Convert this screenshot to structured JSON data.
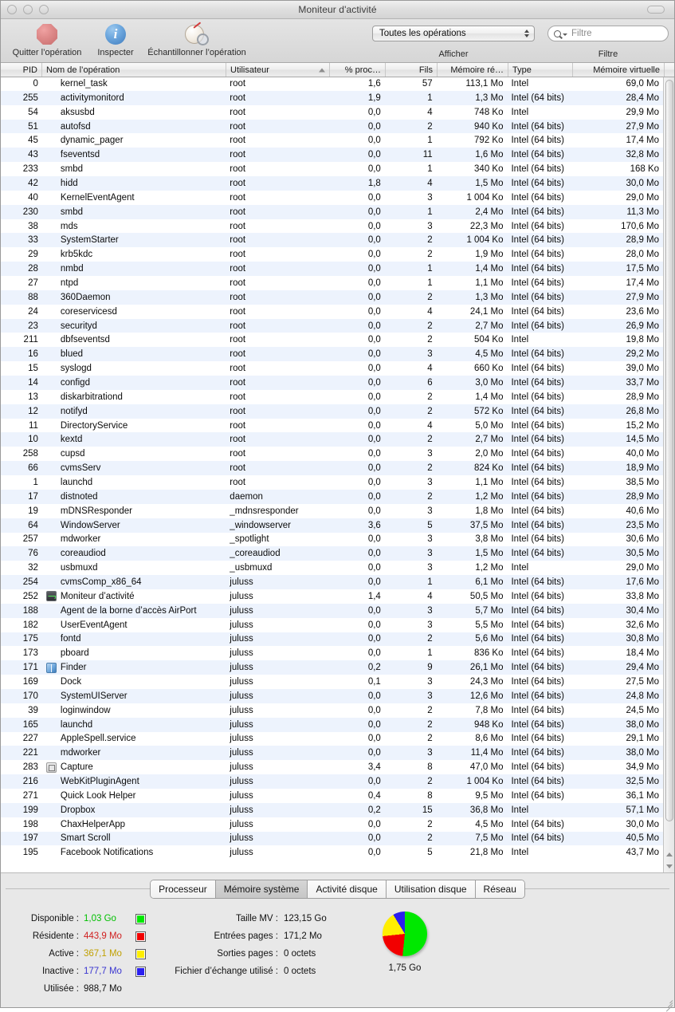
{
  "window": {
    "title": "Moniteur d'activité"
  },
  "toolbar": {
    "quit_label": "Quitter l’opération",
    "inspect_label": "Inspecter",
    "sample_label": "Échantillonner l’opération",
    "show_caption": "Afficher",
    "show_value": "Toutes les opérations",
    "filter_caption": "Filtre",
    "filter_placeholder": "Filtre",
    "filter_value": ""
  },
  "table": {
    "columns": [
      {
        "key": "pid",
        "label": "PID",
        "align": "right"
      },
      {
        "key": "name",
        "label": "Nom de l’opération",
        "align": "left"
      },
      {
        "key": "user",
        "label": "Utilisateur",
        "align": "left",
        "sorted": "asc"
      },
      {
        "key": "cpu",
        "label": "% proc…",
        "align": "right"
      },
      {
        "key": "thr",
        "label": "Fils",
        "align": "right"
      },
      {
        "key": "mem",
        "label": "Mémoire ré…",
        "align": "right"
      },
      {
        "key": "type",
        "label": "Type",
        "align": "left"
      },
      {
        "key": "vm",
        "label": "Mémoire virtuelle",
        "align": "right"
      }
    ],
    "rows": [
      {
        "pid": "0",
        "name": "kernel_task",
        "icon": "",
        "user": "root",
        "cpu": "1,6",
        "thr": "57",
        "mem": "113,1 Mo",
        "type": "Intel",
        "vm": "69,0 Mo"
      },
      {
        "pid": "255",
        "name": "activitymonitord",
        "icon": "",
        "user": "root",
        "cpu": "1,9",
        "thr": "1",
        "mem": "1,3 Mo",
        "type": "Intel (64 bits)",
        "vm": "28,4 Mo"
      },
      {
        "pid": "54",
        "name": "aksusbd",
        "icon": "",
        "user": "root",
        "cpu": "0,0",
        "thr": "4",
        "mem": "748 Ko",
        "type": "Intel",
        "vm": "29,9 Mo"
      },
      {
        "pid": "51",
        "name": "autofsd",
        "icon": "",
        "user": "root",
        "cpu": "0,0",
        "thr": "2",
        "mem": "940 Ko",
        "type": "Intel (64 bits)",
        "vm": "27,9 Mo"
      },
      {
        "pid": "45",
        "name": "dynamic_pager",
        "icon": "",
        "user": "root",
        "cpu": "0,0",
        "thr": "1",
        "mem": "792 Ko",
        "type": "Intel (64 bits)",
        "vm": "17,4 Mo"
      },
      {
        "pid": "43",
        "name": "fseventsd",
        "icon": "",
        "user": "root",
        "cpu": "0,0",
        "thr": "11",
        "mem": "1,6 Mo",
        "type": "Intel (64 bits)",
        "vm": "32,8 Mo"
      },
      {
        "pid": "233",
        "name": "smbd",
        "icon": "",
        "user": "root",
        "cpu": "0,0",
        "thr": "1",
        "mem": "340 Ko",
        "type": "Intel (64 bits)",
        "vm": "168 Ko"
      },
      {
        "pid": "42",
        "name": "hidd",
        "icon": "",
        "user": "root",
        "cpu": "1,8",
        "thr": "4",
        "mem": "1,5 Mo",
        "type": "Intel (64 bits)",
        "vm": "30,0 Mo"
      },
      {
        "pid": "40",
        "name": "KernelEventAgent",
        "icon": "",
        "user": "root",
        "cpu": "0,0",
        "thr": "3",
        "mem": "1 004 Ko",
        "type": "Intel (64 bits)",
        "vm": "29,0 Mo"
      },
      {
        "pid": "230",
        "name": "smbd",
        "icon": "",
        "user": "root",
        "cpu": "0,0",
        "thr": "1",
        "mem": "2,4 Mo",
        "type": "Intel (64 bits)",
        "vm": "11,3 Mo"
      },
      {
        "pid": "38",
        "name": "mds",
        "icon": "",
        "user": "root",
        "cpu": "0,0",
        "thr": "3",
        "mem": "22,3 Mo",
        "type": "Intel (64 bits)",
        "vm": "170,6 Mo"
      },
      {
        "pid": "33",
        "name": "SystemStarter",
        "icon": "",
        "user": "root",
        "cpu": "0,0",
        "thr": "2",
        "mem": "1 004 Ko",
        "type": "Intel (64 bits)",
        "vm": "28,9 Mo"
      },
      {
        "pid": "29",
        "name": "krb5kdc",
        "icon": "",
        "user": "root",
        "cpu": "0,0",
        "thr": "2",
        "mem": "1,9 Mo",
        "type": "Intel (64 bits)",
        "vm": "28,0 Mo"
      },
      {
        "pid": "28",
        "name": "nmbd",
        "icon": "",
        "user": "root",
        "cpu": "0,0",
        "thr": "1",
        "mem": "1,4 Mo",
        "type": "Intel (64 bits)",
        "vm": "17,5 Mo"
      },
      {
        "pid": "27",
        "name": "ntpd",
        "icon": "",
        "user": "root",
        "cpu": "0,0",
        "thr": "1",
        "mem": "1,1 Mo",
        "type": "Intel (64 bits)",
        "vm": "17,4 Mo"
      },
      {
        "pid": "88",
        "name": "360Daemon",
        "icon": "",
        "user": "root",
        "cpu": "0,0",
        "thr": "2",
        "mem": "1,3 Mo",
        "type": "Intel (64 bits)",
        "vm": "27,9 Mo"
      },
      {
        "pid": "24",
        "name": "coreservicesd",
        "icon": "",
        "user": "root",
        "cpu": "0,0",
        "thr": "4",
        "mem": "24,1 Mo",
        "type": "Intel (64 bits)",
        "vm": "23,6 Mo"
      },
      {
        "pid": "23",
        "name": "securityd",
        "icon": "",
        "user": "root",
        "cpu": "0,0",
        "thr": "2",
        "mem": "2,7 Mo",
        "type": "Intel (64 bits)",
        "vm": "26,9 Mo"
      },
      {
        "pid": "211",
        "name": "dbfseventsd",
        "icon": "",
        "user": "root",
        "cpu": "0,0",
        "thr": "2",
        "mem": "504 Ko",
        "type": "Intel",
        "vm": "19,8 Mo"
      },
      {
        "pid": "16",
        "name": "blued",
        "icon": "",
        "user": "root",
        "cpu": "0,0",
        "thr": "3",
        "mem": "4,5 Mo",
        "type": "Intel (64 bits)",
        "vm": "29,2 Mo"
      },
      {
        "pid": "15",
        "name": "syslogd",
        "icon": "",
        "user": "root",
        "cpu": "0,0",
        "thr": "4",
        "mem": "660 Ko",
        "type": "Intel (64 bits)",
        "vm": "39,0 Mo"
      },
      {
        "pid": "14",
        "name": "configd",
        "icon": "",
        "user": "root",
        "cpu": "0,0",
        "thr": "6",
        "mem": "3,0 Mo",
        "type": "Intel (64 bits)",
        "vm": "33,7 Mo"
      },
      {
        "pid": "13",
        "name": "diskarbitrationd",
        "icon": "",
        "user": "root",
        "cpu": "0,0",
        "thr": "2",
        "mem": "1,4 Mo",
        "type": "Intel (64 bits)",
        "vm": "28,9 Mo"
      },
      {
        "pid": "12",
        "name": "notifyd",
        "icon": "",
        "user": "root",
        "cpu": "0,0",
        "thr": "2",
        "mem": "572 Ko",
        "type": "Intel (64 bits)",
        "vm": "26,8 Mo"
      },
      {
        "pid": "11",
        "name": "DirectoryService",
        "icon": "",
        "user": "root",
        "cpu": "0,0",
        "thr": "4",
        "mem": "5,0 Mo",
        "type": "Intel (64 bits)",
        "vm": "15,2 Mo"
      },
      {
        "pid": "10",
        "name": "kextd",
        "icon": "",
        "user": "root",
        "cpu": "0,0",
        "thr": "2",
        "mem": "2,7 Mo",
        "type": "Intel (64 bits)",
        "vm": "14,5 Mo"
      },
      {
        "pid": "258",
        "name": "cupsd",
        "icon": "",
        "user": "root",
        "cpu": "0,0",
        "thr": "3",
        "mem": "2,0 Mo",
        "type": "Intel (64 bits)",
        "vm": "40,0 Mo"
      },
      {
        "pid": "66",
        "name": "cvmsServ",
        "icon": "",
        "user": "root",
        "cpu": "0,0",
        "thr": "2",
        "mem": "824 Ko",
        "type": "Intel (64 bits)",
        "vm": "18,9 Mo"
      },
      {
        "pid": "1",
        "name": "launchd",
        "icon": "",
        "user": "root",
        "cpu": "0,0",
        "thr": "3",
        "mem": "1,1 Mo",
        "type": "Intel (64 bits)",
        "vm": "38,5 Mo"
      },
      {
        "pid": "17",
        "name": "distnoted",
        "icon": "",
        "user": "daemon",
        "cpu": "0,0",
        "thr": "2",
        "mem": "1,2 Mo",
        "type": "Intel (64 bits)",
        "vm": "28,9 Mo"
      },
      {
        "pid": "19",
        "name": "mDNSResponder",
        "icon": "",
        "user": "_mdnsresponder",
        "cpu": "0,0",
        "thr": "3",
        "mem": "1,8 Mo",
        "type": "Intel (64 bits)",
        "vm": "40,6 Mo"
      },
      {
        "pid": "64",
        "name": "WindowServer",
        "icon": "",
        "user": "_windowserver",
        "cpu": "3,6",
        "thr": "5",
        "mem": "37,5 Mo",
        "type": "Intel (64 bits)",
        "vm": "23,5 Mo"
      },
      {
        "pid": "257",
        "name": "mdworker",
        "icon": "",
        "user": "_spotlight",
        "cpu": "0,0",
        "thr": "3",
        "mem": "3,8 Mo",
        "type": "Intel (64 bits)",
        "vm": "30,6 Mo"
      },
      {
        "pid": "76",
        "name": "coreaudiod",
        "icon": "",
        "user": "_coreaudiod",
        "cpu": "0,0",
        "thr": "3",
        "mem": "1,5 Mo",
        "type": "Intel (64 bits)",
        "vm": "30,5 Mo"
      },
      {
        "pid": "32",
        "name": "usbmuxd",
        "icon": "",
        "user": "_usbmuxd",
        "cpu": "0,0",
        "thr": "3",
        "mem": "1,2 Mo",
        "type": "Intel",
        "vm": "29,0 Mo"
      },
      {
        "pid": "254",
        "name": "cvmsComp_x86_64",
        "icon": "",
        "user": "juluss",
        "cpu": "0,0",
        "thr": "1",
        "mem": "6,1 Mo",
        "type": "Intel (64 bits)",
        "vm": "17,6 Mo"
      },
      {
        "pid": "252",
        "name": "Moniteur d’activité",
        "icon": "am",
        "user": "juluss",
        "cpu": "1,4",
        "thr": "4",
        "mem": "50,5 Mo",
        "type": "Intel (64 bits)",
        "vm": "33,8 Mo"
      },
      {
        "pid": "188",
        "name": "Agent de la borne d’accès AirPort",
        "icon": "",
        "user": "juluss",
        "cpu": "0,0",
        "thr": "3",
        "mem": "5,7 Mo",
        "type": "Intel (64 bits)",
        "vm": "30,4 Mo"
      },
      {
        "pid": "182",
        "name": "UserEventAgent",
        "icon": "",
        "user": "juluss",
        "cpu": "0,0",
        "thr": "3",
        "mem": "5,5 Mo",
        "type": "Intel (64 bits)",
        "vm": "32,6 Mo"
      },
      {
        "pid": "175",
        "name": "fontd",
        "icon": "",
        "user": "juluss",
        "cpu": "0,0",
        "thr": "2",
        "mem": "5,6 Mo",
        "type": "Intel (64 bits)",
        "vm": "30,8 Mo"
      },
      {
        "pid": "173",
        "name": "pboard",
        "icon": "",
        "user": "juluss",
        "cpu": "0,0",
        "thr": "1",
        "mem": "836 Ko",
        "type": "Intel (64 bits)",
        "vm": "18,4 Mo"
      },
      {
        "pid": "171",
        "name": "Finder",
        "icon": "finder",
        "user": "juluss",
        "cpu": "0,2",
        "thr": "9",
        "mem": "26,1 Mo",
        "type": "Intel (64 bits)",
        "vm": "29,4 Mo"
      },
      {
        "pid": "169",
        "name": "Dock",
        "icon": "",
        "user": "juluss",
        "cpu": "0,1",
        "thr": "3",
        "mem": "24,3 Mo",
        "type": "Intel (64 bits)",
        "vm": "27,5 Mo"
      },
      {
        "pid": "170",
        "name": "SystemUIServer",
        "icon": "",
        "user": "juluss",
        "cpu": "0,0",
        "thr": "3",
        "mem": "12,6 Mo",
        "type": "Intel (64 bits)",
        "vm": "24,8 Mo"
      },
      {
        "pid": "39",
        "name": "loginwindow",
        "icon": "",
        "user": "juluss",
        "cpu": "0,0",
        "thr": "2",
        "mem": "7,8 Mo",
        "type": "Intel (64 bits)",
        "vm": "24,5 Mo"
      },
      {
        "pid": "165",
        "name": "launchd",
        "icon": "",
        "user": "juluss",
        "cpu": "0,0",
        "thr": "2",
        "mem": "948 Ko",
        "type": "Intel (64 bits)",
        "vm": "38,0 Mo"
      },
      {
        "pid": "227",
        "name": "AppleSpell.service",
        "icon": "",
        "user": "juluss",
        "cpu": "0,0",
        "thr": "2",
        "mem": "8,6 Mo",
        "type": "Intel (64 bits)",
        "vm": "29,1 Mo"
      },
      {
        "pid": "221",
        "name": "mdworker",
        "icon": "",
        "user": "juluss",
        "cpu": "0,0",
        "thr": "3",
        "mem": "11,4 Mo",
        "type": "Intel (64 bits)",
        "vm": "38,0 Mo"
      },
      {
        "pid": "283",
        "name": "Capture",
        "icon": "capture",
        "user": "juluss",
        "cpu": "3,4",
        "thr": "8",
        "mem": "47,0 Mo",
        "type": "Intel (64 bits)",
        "vm": "34,9 Mo"
      },
      {
        "pid": "216",
        "name": "WebKitPluginAgent",
        "icon": "",
        "user": "juluss",
        "cpu": "0,0",
        "thr": "2",
        "mem": "1 004 Ko",
        "type": "Intel (64 bits)",
        "vm": "32,5 Mo"
      },
      {
        "pid": "271",
        "name": "Quick Look Helper",
        "icon": "",
        "user": "juluss",
        "cpu": "0,4",
        "thr": "8",
        "mem": "9,5 Mo",
        "type": "Intel (64 bits)",
        "vm": "36,1 Mo"
      },
      {
        "pid": "199",
        "name": "Dropbox",
        "icon": "",
        "user": "juluss",
        "cpu": "0,2",
        "thr": "15",
        "mem": "36,8 Mo",
        "type": "Intel",
        "vm": "57,1 Mo"
      },
      {
        "pid": "198",
        "name": "ChaxHelperApp",
        "icon": "",
        "user": "juluss",
        "cpu": "0,0",
        "thr": "2",
        "mem": "4,5 Mo",
        "type": "Intel (64 bits)",
        "vm": "30,0 Mo"
      },
      {
        "pid": "197",
        "name": "Smart Scroll",
        "icon": "",
        "user": "juluss",
        "cpu": "0,0",
        "thr": "2",
        "mem": "7,5 Mo",
        "type": "Intel (64 bits)",
        "vm": "40,5 Mo"
      },
      {
        "pid": "195",
        "name": "Facebook Notifications",
        "icon": "",
        "user": "juluss",
        "cpu": "0,0",
        "thr": "5",
        "mem": "21,8 Mo",
        "type": "Intel",
        "vm": "43,7 Mo"
      }
    ]
  },
  "bottom": {
    "tabs": [
      {
        "label": "Processeur",
        "selected": false
      },
      {
        "label": "Mémoire système",
        "selected": true
      },
      {
        "label": "Activité disque",
        "selected": false
      },
      {
        "label": "Utilisation disque",
        "selected": false
      },
      {
        "label": "Réseau",
        "selected": false
      }
    ],
    "memory_legend": [
      {
        "label": "Disponible :",
        "value": "1,03 Go",
        "color": "#00c000",
        "swatch": "#00e800"
      },
      {
        "label": "Résidente :",
        "value": "443,9 Mo",
        "color": "#d02020",
        "swatch": "#f20000"
      },
      {
        "label": "Active :",
        "value": "367,1 Mo",
        "color": "#c0a000",
        "swatch": "#ffee00"
      },
      {
        "label": "Inactive :",
        "value": "177,7 Mo",
        "color": "#3a36d0",
        "swatch": "#2a1ff0"
      },
      {
        "label": "Utilisée :",
        "value": "988,7 Mo",
        "color": "#111111",
        "swatch": ""
      }
    ],
    "vm_stats": [
      {
        "label": "Taille MV :",
        "value": "123,15 Go"
      },
      {
        "label": "Entrées pages :",
        "value": "171,2 Mo"
      },
      {
        "label": "Sorties pages :",
        "value": "0 octets"
      },
      {
        "label": "Fichier d’échange utilisé :",
        "value": "0 octets"
      }
    ],
    "pie_total": "1,75 Go"
  },
  "chart_data": {
    "type": "pie",
    "title": "Mémoire système",
    "categories": [
      "Disponible",
      "Résidente",
      "Active",
      "Inactive"
    ],
    "values": [
      1054.72,
      443.9,
      367.1,
      177.7
    ],
    "unit": "Mo",
    "labels": [
      "1,03 Go",
      "443,9 Mo",
      "367,1 Mo",
      "177,7 Mo"
    ],
    "colors": [
      "#00e800",
      "#f20000",
      "#ffee00",
      "#2a1ff0"
    ],
    "total_label": "1,75 Go",
    "legend": "left"
  }
}
